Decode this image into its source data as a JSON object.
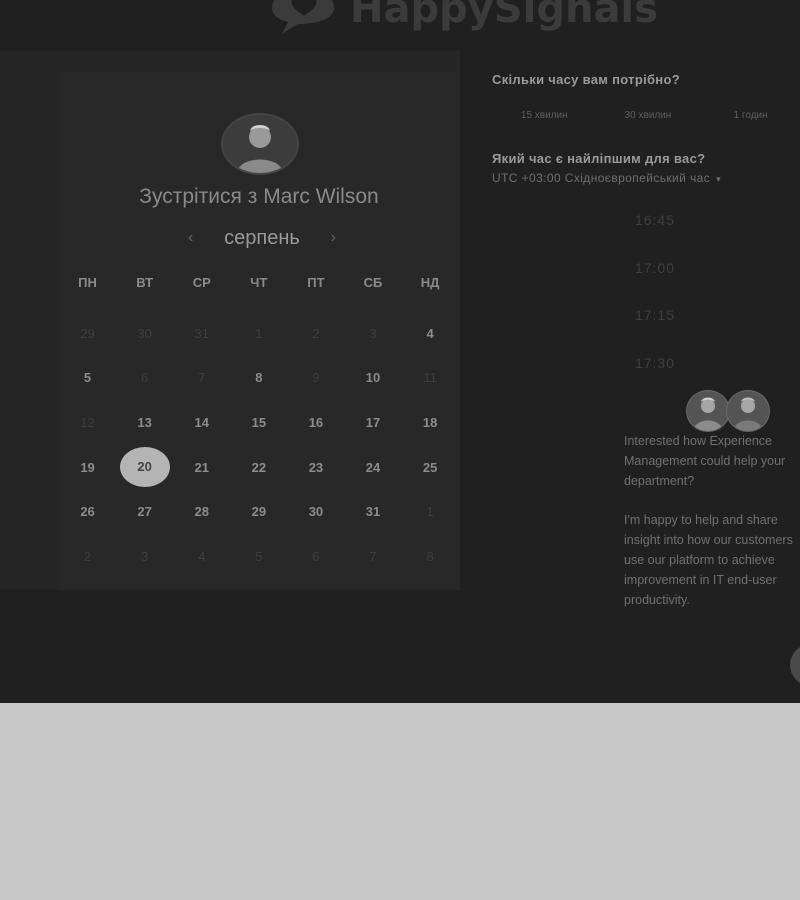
{
  "brand": {
    "name": "HappySignals",
    "logo_icon": "speech-bubble-heart-icon"
  },
  "booking": {
    "title": "Зустрітися з Marc Wilson",
    "month": "серпень",
    "weekdays": [
      "ПН",
      "ВТ",
      "СР",
      "ЧТ",
      "ПТ",
      "СБ",
      "НД"
    ],
    "weeks": [
      [
        {
          "d": "29",
          "s": "dim"
        },
        {
          "d": "30",
          "s": "dim"
        },
        {
          "d": "31",
          "s": "dim"
        },
        {
          "d": "1",
          "s": "dim"
        },
        {
          "d": "2",
          "s": "dim"
        },
        {
          "d": "3",
          "s": "dim"
        },
        {
          "d": "4",
          "s": "avail"
        }
      ],
      [
        {
          "d": "5",
          "s": "avail"
        },
        {
          "d": "6",
          "s": "dim"
        },
        {
          "d": "7",
          "s": "dim"
        },
        {
          "d": "8",
          "s": "avail"
        },
        {
          "d": "9",
          "s": "dim"
        },
        {
          "d": "10",
          "s": "avail"
        },
        {
          "d": "11",
          "s": "dim"
        }
      ],
      [
        {
          "d": "12",
          "s": "dim"
        },
        {
          "d": "13",
          "s": "avail"
        },
        {
          "d": "14",
          "s": "avail"
        },
        {
          "d": "15",
          "s": "avail"
        },
        {
          "d": "16",
          "s": "avail"
        },
        {
          "d": "17",
          "s": "avail"
        },
        {
          "d": "18",
          "s": "avail"
        }
      ],
      [
        {
          "d": "19",
          "s": "avail"
        },
        {
          "d": "20",
          "s": "selected"
        },
        {
          "d": "21",
          "s": "avail"
        },
        {
          "d": "22",
          "s": "avail"
        },
        {
          "d": "23",
          "s": "avail"
        },
        {
          "d": "24",
          "s": "avail"
        },
        {
          "d": "25",
          "s": "avail"
        }
      ],
      [
        {
          "d": "26",
          "s": "avail"
        },
        {
          "d": "27",
          "s": "avail"
        },
        {
          "d": "28",
          "s": "avail"
        },
        {
          "d": "29",
          "s": "avail"
        },
        {
          "d": "30",
          "s": "avail"
        },
        {
          "d": "31",
          "s": "avail"
        },
        {
          "d": "1",
          "s": "dim"
        }
      ],
      [
        {
          "d": "2",
          "s": "dim"
        },
        {
          "d": "3",
          "s": "dim"
        },
        {
          "d": "4",
          "s": "dim"
        },
        {
          "d": "5",
          "s": "dim"
        },
        {
          "d": "6",
          "s": "dim"
        },
        {
          "d": "7",
          "s": "dim"
        },
        {
          "d": "8",
          "s": "dim"
        }
      ]
    ]
  },
  "duration": {
    "question": "Скільки часу вам потрібно?",
    "options": [
      "15 хвилин",
      "30 хвилин",
      "1 годин"
    ]
  },
  "time": {
    "question": "Який час є найліпшим для вас?",
    "timezone": "UTC +03:00 Східноєвропейський час",
    "slots": [
      "16:45",
      "17:00",
      "17:15",
      "17:30"
    ]
  },
  "promo": {
    "p1": "Interested how Experience Management could help your department?",
    "p2": "I'm happy to help and share insight into how our customers use our platform to achieve improvement in IT end-user productivity."
  },
  "colors": {
    "page_bg": "#c8c8c8",
    "panel_bg": "#202020",
    "selected_day": "#b4b4b4"
  }
}
